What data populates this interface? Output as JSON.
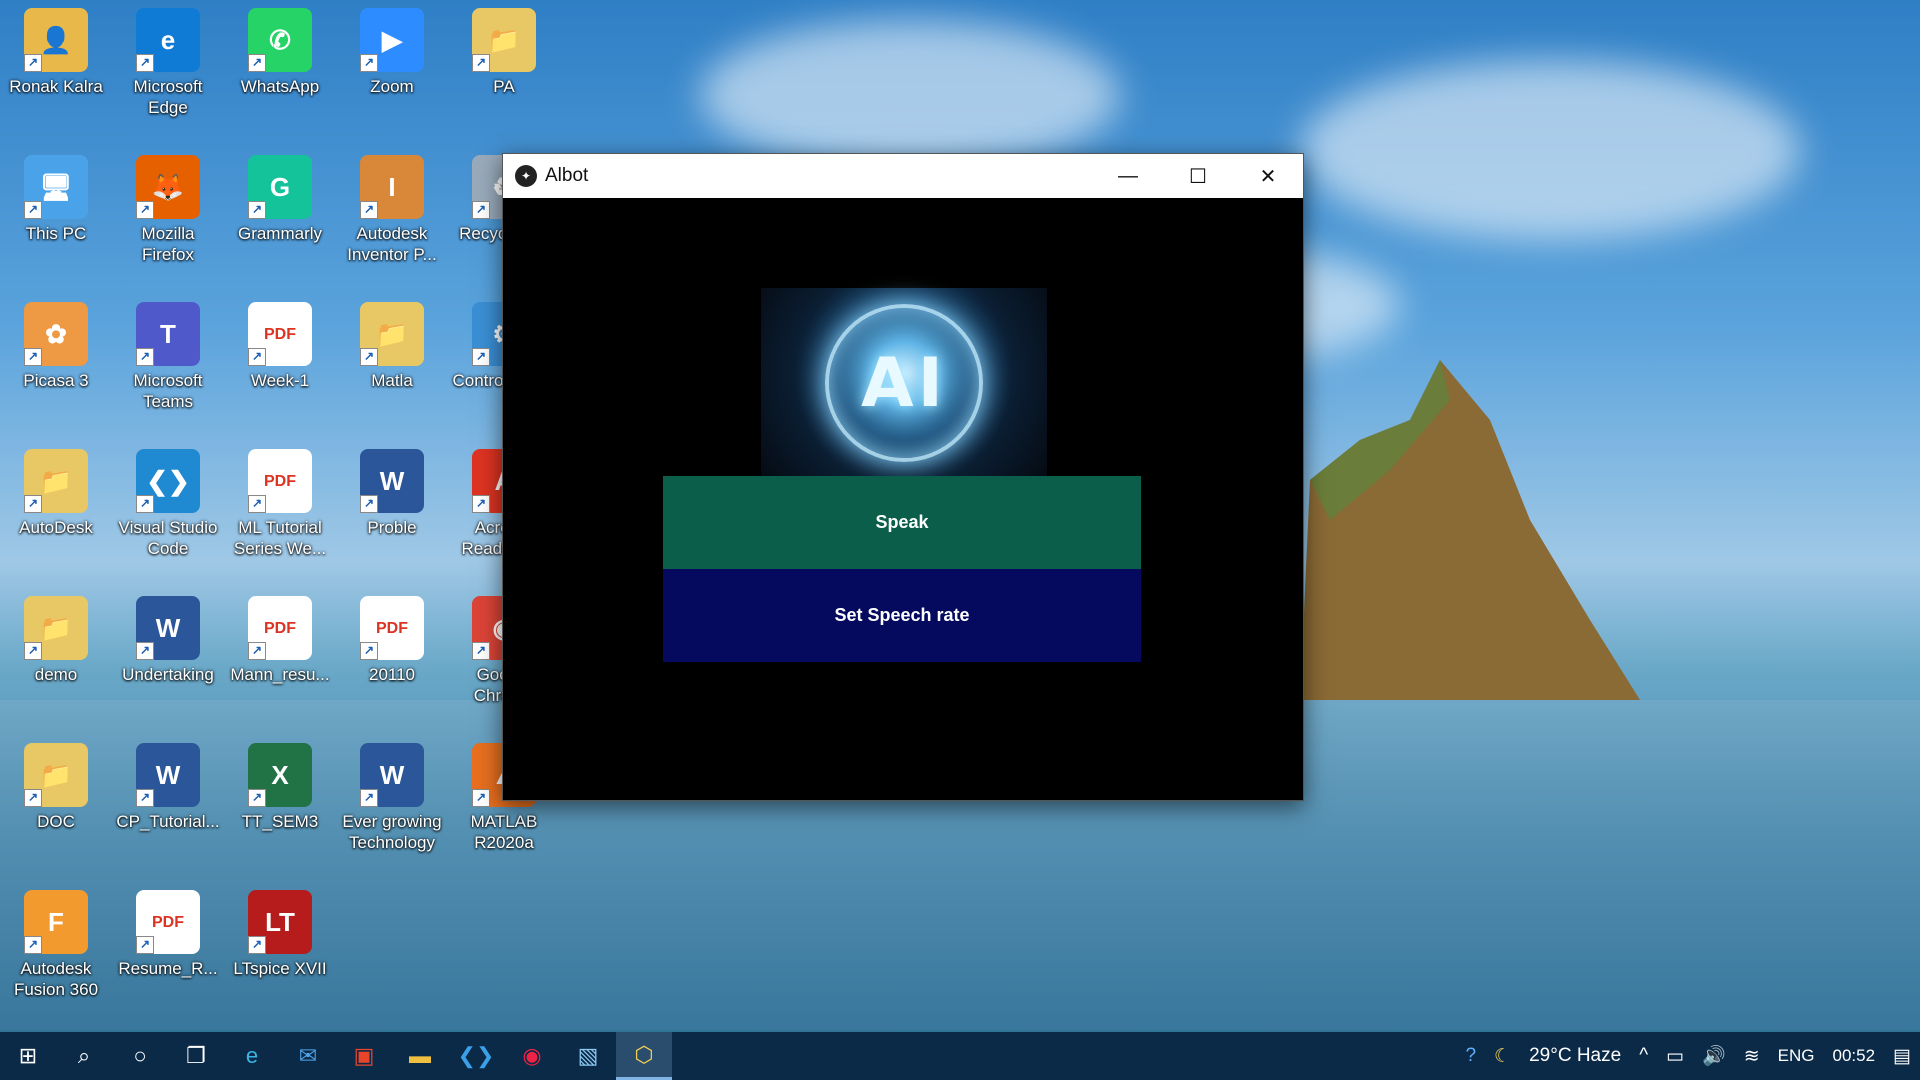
{
  "desktop": {
    "icons": [
      {
        "label": "Ronak Kalra",
        "glyph": "👤",
        "color": "#e8b84a"
      },
      {
        "label": "Microsoft Edge",
        "glyph": "e",
        "color": "#0f7bd4"
      },
      {
        "label": "WhatsApp",
        "glyph": "✆",
        "color": "#25d366"
      },
      {
        "label": "Zoom",
        "glyph": "▶",
        "color": "#2d8cff"
      },
      {
        "label": "PA",
        "glyph": "📁",
        "color": "#e8c765"
      },
      {
        "label": "This PC",
        "glyph": "🖥",
        "color": "#4aa3e8"
      },
      {
        "label": "Mozilla Firefox",
        "glyph": "🦊",
        "color": "#e66000"
      },
      {
        "label": "Grammarly",
        "glyph": "G",
        "color": "#15c39a"
      },
      {
        "label": "Autodesk Inventor P...",
        "glyph": "I",
        "color": "#d9883a"
      },
      {
        "label": "Recycle Bin",
        "glyph": "♻",
        "color": "#9ab"
      },
      {
        "label": "Picasa 3",
        "glyph": "✿",
        "color": "#e94"
      },
      {
        "label": "Microsoft Teams",
        "glyph": "T",
        "color": "#5059c9"
      },
      {
        "label": "Week-1",
        "glyph": "PDF",
        "color": "#d32"
      },
      {
        "label": "Matla",
        "glyph": "📁",
        "color": "#e8c765"
      },
      {
        "label": "Control Panel",
        "glyph": "⚙",
        "color": "#3a8fd4"
      },
      {
        "label": "AutoDesk",
        "glyph": "📁",
        "color": "#e8c765"
      },
      {
        "label": "Visual Studio Code",
        "glyph": "❮❯",
        "color": "#1f8ad2"
      },
      {
        "label": "ML Tutorial Series We...",
        "glyph": "PDF",
        "color": "#d32"
      },
      {
        "label": "Proble",
        "glyph": "W",
        "color": "#2b579a"
      },
      {
        "label": "Acrobat Reader DC",
        "glyph": "A",
        "color": "#d32"
      },
      {
        "label": "demo",
        "glyph": "📁",
        "color": "#e8c765"
      },
      {
        "label": "Undertaking",
        "glyph": "W",
        "color": "#2b579a"
      },
      {
        "label": "Mann_resu...",
        "glyph": "PDF",
        "color": "#d32"
      },
      {
        "label": "20110",
        "glyph": "PDF",
        "color": "#d32"
      },
      {
        "label": "Google Chrome",
        "glyph": "◉",
        "color": "#db4437"
      },
      {
        "label": "DOC",
        "glyph": "📁",
        "color": "#e8c765"
      },
      {
        "label": "CP_Tutorial...",
        "glyph": "W",
        "color": "#2b579a"
      },
      {
        "label": "TT_SEM3",
        "glyph": "X",
        "color": "#217346"
      },
      {
        "label": "Ever growing Technology",
        "glyph": "W",
        "color": "#2b579a"
      },
      {
        "label": "MATLAB R2020a",
        "glyph": "▲",
        "color": "#e76f1f"
      },
      {
        "label": "Autodesk Fusion 360",
        "glyph": "F",
        "color": "#f29a2e"
      },
      {
        "label": "Resume_R...",
        "glyph": "PDF",
        "color": "#d32"
      },
      {
        "label": "LTspice XVII",
        "glyph": "LT",
        "color": "#b71c1c"
      }
    ]
  },
  "window": {
    "title": "Albot",
    "image_label": "AI",
    "speak_label": "Speak",
    "rate_label": "Set Speech rate"
  },
  "taskbar": {
    "items": [
      "windows-start-icon",
      "search-icon",
      "cortana-icon",
      "task-view-icon",
      "edge-icon",
      "mail-icon",
      "office-icon",
      "file-explorer-icon",
      "vscode-icon",
      "chrome-icon",
      "photos-icon",
      "python-icon"
    ],
    "weather": "29°C Haze",
    "language": "ENG",
    "time": "00:52"
  }
}
